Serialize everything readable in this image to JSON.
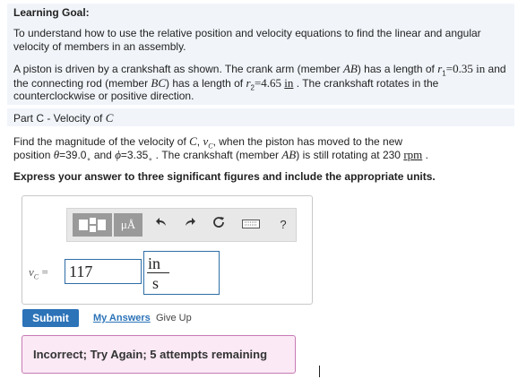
{
  "goal": {
    "heading": "Learning Goal:",
    "line1": "To understand how to use the relative position and velocity equations to find the linear and angular",
    "line2": "velocity of members in an assembly.",
    "p2_a": "A piston is driven by a crankshaft as shown. The crank arm (member ",
    "p2_ab": "AB",
    "p2_b": ") has a length of ",
    "p2_r1": "r",
    "p2_r1sub": "1",
    "p2_c": "=0.35 ",
    "p2_unit1": "in",
    "p2_d": " and",
    "p3_a": "the connecting rod (member ",
    "p3_bc": "BC",
    "p3_b": ") has a length of ",
    "p3_r2": "r",
    "p3_r2sub": "2",
    "p3_c": "=4.65 ",
    "p3_unit2": "in",
    "p3_d": " . The crankshaft rotates in the",
    "p4": "counterclockwise or positive direction."
  },
  "part": {
    "title_a": "Part C - Velocity of ",
    "title_c": "C"
  },
  "question": {
    "q1_a": "Find the magnitude of the velocity of ",
    "q1_c": "C",
    "q1_b": ", ",
    "q1_v": "v",
    "q1_vsub": "C",
    "q1_d": ", when the piston has moved to the new",
    "q2_a": "position ",
    "q2_theta": "θ",
    "q2_b": "=39.0",
    "q2_deg": "∘",
    "q2_c": " and ",
    "q2_phi": "ϕ",
    "q2_d": "=3.35",
    "q2_deg2": "∘",
    "q2_e": " . The crankshaft (member ",
    "q2_ab": "AB",
    "q2_f": ") is still rotating at 230 ",
    "q2_rpm": "rpm",
    "q2_g": " .",
    "instruction": "Express your answer to three significant figures and include the appropriate units."
  },
  "toolbar": {
    "templates_icon": "templates-icon",
    "units_label": "μÅ",
    "undo_icon": "undo-icon",
    "redo_icon": "redo-icon",
    "reset_icon": "reset-icon",
    "keyboard_icon": "keyboard-icon",
    "help_label": "?"
  },
  "answer": {
    "var_v": "v",
    "var_sub": "C",
    "equals": "=",
    "value": "117",
    "unit_num": "in",
    "unit_den": "s"
  },
  "actions": {
    "submit": "Submit",
    "my_answers": "My Answers",
    "give_up": "Give Up"
  },
  "feedback": {
    "message": "Incorrect; Try Again; 5 attempts remaining"
  },
  "colors": {
    "accent": "#2c73b8",
    "feedback_bg": "#fbe9f5",
    "feedback_border": "#c87ab4",
    "goal_bg": "#f1f5fa"
  }
}
